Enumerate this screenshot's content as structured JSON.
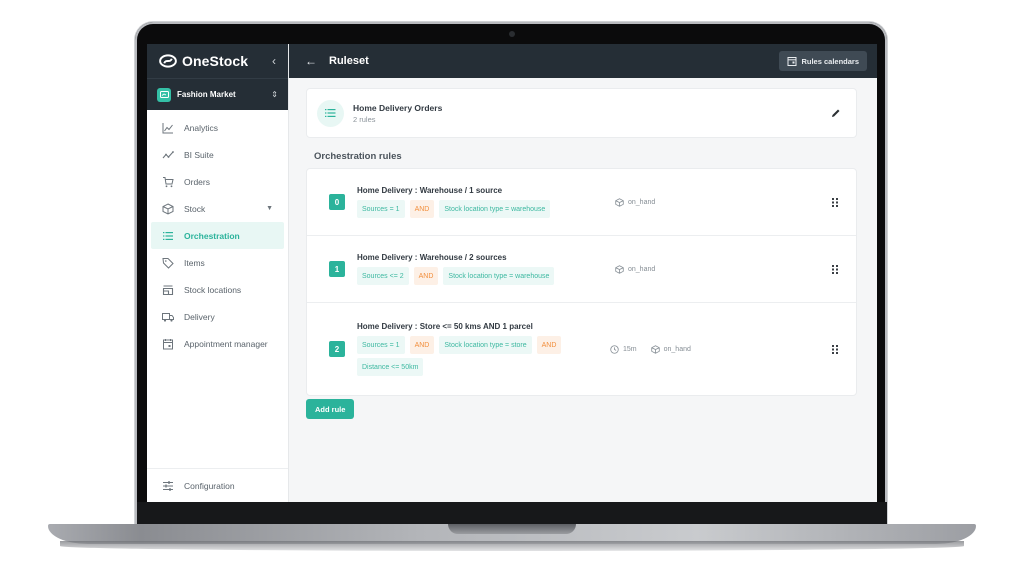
{
  "brand": {
    "name": "OneStock",
    "collapse_icon": "chevron-left-icon"
  },
  "store_switcher": {
    "name": "Fashion Market",
    "toggle_icon": "unfold-icon"
  },
  "sidebar": {
    "items": [
      {
        "label": "Analytics",
        "icon": "line-chart-icon",
        "active": false
      },
      {
        "label": "BI Suite",
        "icon": "trend-icon",
        "active": false
      },
      {
        "label": "Orders",
        "icon": "cart-icon",
        "active": false
      },
      {
        "label": "Stock",
        "icon": "box-icon",
        "active": false,
        "has_submenu": true
      },
      {
        "label": "Orchestration",
        "icon": "list-icon",
        "active": true
      },
      {
        "label": "Items",
        "icon": "tag-icon",
        "active": false
      },
      {
        "label": "Stock locations",
        "icon": "store-icon",
        "active": false
      },
      {
        "label": "Delivery",
        "icon": "truck-icon",
        "active": false
      },
      {
        "label": "Appointment manager",
        "icon": "calendar-icon",
        "active": false
      }
    ],
    "bottom": {
      "label": "Configuration",
      "icon": "sliders-icon"
    }
  },
  "header": {
    "title": "Ruleset",
    "back_icon": "arrow-left-icon",
    "rules_calendars_label": "Rules calendars"
  },
  "ruleset": {
    "name": "Home Delivery Orders",
    "count_label": "2 rules"
  },
  "section_title": "Orchestration rules",
  "rules": [
    {
      "index": "0",
      "name": "Home Delivery : Warehouse / 1 source",
      "conditions": [
        "Sources = 1",
        "AND",
        "Stock location type = warehouse"
      ],
      "meta": {
        "time": null,
        "stock": "on_hand"
      }
    },
    {
      "index": "1",
      "name": "Home Delivery : Warehouse / 2 sources",
      "conditions": [
        "Sources <= 2",
        "AND",
        "Stock location type = warehouse"
      ],
      "meta": {
        "time": null,
        "stock": "on_hand"
      }
    },
    {
      "index": "2",
      "name": "Home Delivery : Store <= 50 kms AND 1 parcel",
      "conditions": [
        "Sources = 1",
        "AND",
        "Stock location type = store",
        "AND",
        "Distance <= 50km"
      ],
      "meta": {
        "time": "15m",
        "stock": "on_hand"
      }
    }
  ],
  "add_rule_label": "Add rule",
  "colors": {
    "accent": "#2bb39b",
    "dark": "#252e36",
    "and_chip": "#f28e3c"
  }
}
